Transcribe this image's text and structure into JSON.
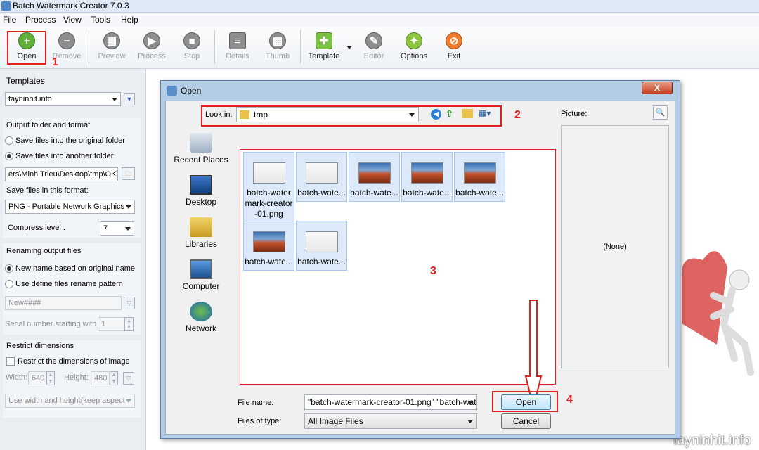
{
  "app": {
    "title": "Batch Watermark Creator 7.0.3"
  },
  "menu": [
    "File",
    "Process",
    "View",
    "Tools",
    "Help"
  ],
  "toolbar": [
    {
      "label": "Open",
      "icon": "plus-icon",
      "enabled": true,
      "color": "#5fb13a"
    },
    {
      "label": "Remove",
      "icon": "minus-icon",
      "enabled": false
    },
    {
      "label": "Preview",
      "icon": "preview-icon",
      "enabled": false
    },
    {
      "label": "Process",
      "icon": "play-icon",
      "enabled": false
    },
    {
      "label": "Stop",
      "icon": "stop-icon",
      "enabled": false
    },
    {
      "label": "Details",
      "icon": "details-icon",
      "enabled": false
    },
    {
      "label": "Thumb",
      "icon": "thumb-icon",
      "enabled": false
    },
    {
      "label": "Template",
      "icon": "puzzle-icon",
      "enabled": true,
      "color": "#7cc242"
    },
    {
      "label": "Editor",
      "icon": "pencil-icon",
      "enabled": false
    },
    {
      "label": "Options",
      "icon": "wrench-icon",
      "enabled": true,
      "color": "#8cc63f"
    },
    {
      "label": "Exit",
      "icon": "exit-icon",
      "enabled": true,
      "color": "#f07a2a"
    }
  ],
  "annotations": {
    "n1": "1",
    "n2": "2",
    "n3": "3",
    "n4": "4"
  },
  "left": {
    "templates_label": "Templates",
    "template_value": "tayninhit.info",
    "output_title": "Output folder and format",
    "save_original": "Save files into the original folder",
    "save_another": "Save files into another folder",
    "folder_path": "ers\\Minh Trieu\\Desktop\\tmp\\OK\\",
    "format_label": "Save files in this format:",
    "format_value": "PNG - Portable Network Graphics",
    "compress_label": "Compress level :",
    "compress_value": "7",
    "rename_title": "Renaming output files",
    "rename_original": "New name based on original name",
    "rename_pattern": "Use define files rename pattern",
    "pattern_value": "New####",
    "serial_label": "Serial number starting with",
    "serial_value": "1",
    "restrict_title": "Restrict dimensions",
    "restrict_check": "Restrict the dimensions of image",
    "width_label": "Width:",
    "width_value": "640",
    "height_label": "Height:",
    "height_value": "480",
    "dim_mode": "Use width and height(keep aspect"
  },
  "dialog": {
    "title": "Open",
    "close": "X",
    "look_in_label": "Look in:",
    "look_in_value": "tmp",
    "picture_label": "Picture:",
    "preview_none": "(None)",
    "places": [
      "Recent Places",
      "Desktop",
      "Libraries",
      "Computer",
      "Network"
    ],
    "files": [
      {
        "name": "batch-water mark-creator -01.png",
        "kind": "shot"
      },
      {
        "name": "batch-wate...",
        "kind": "shot"
      },
      {
        "name": "batch-wate...",
        "kind": "desert"
      },
      {
        "name": "batch-wate...",
        "kind": "desert"
      },
      {
        "name": "batch-wate...",
        "kind": "desert"
      },
      {
        "name": "batch-wate...",
        "kind": "desert"
      },
      {
        "name": "batch-wate...",
        "kind": "shot"
      }
    ],
    "file_name_label": "File name:",
    "file_name_value": "\"batch-watermark-creator-01.png\" \"batch-wate",
    "file_type_label": "Files of type:",
    "file_type_value": "All Image Files",
    "open_btn": "Open",
    "cancel_btn": "Cancel"
  },
  "watermark": "tayninhit.info"
}
